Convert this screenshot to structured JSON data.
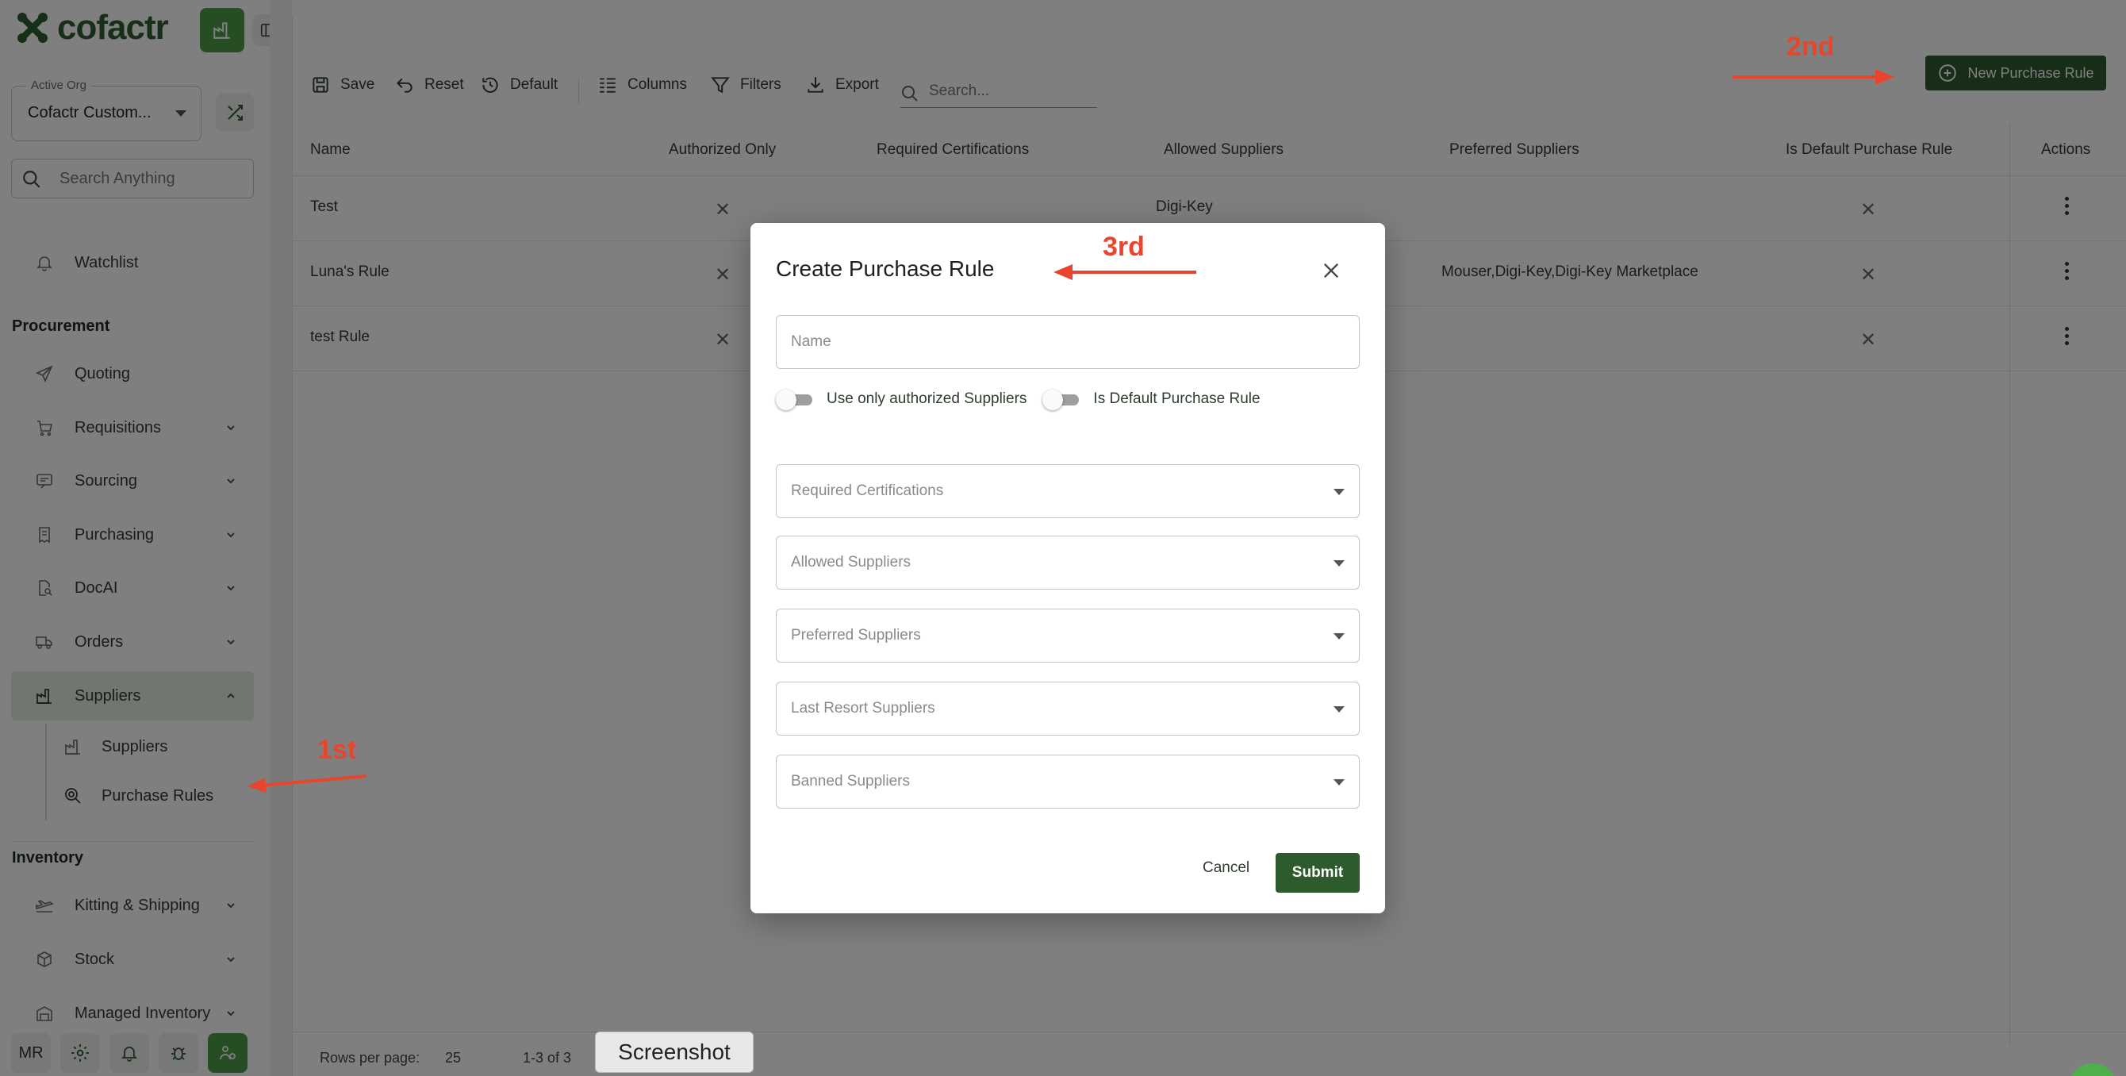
{
  "app": {
    "logo_text": "cofactr"
  },
  "org": {
    "label": "Active Org",
    "value": "Cofactr Custom..."
  },
  "sidebar_search": {
    "placeholder": "Search Anything"
  },
  "nav": {
    "watchlist": "Watchlist",
    "procurement_title": "Procurement",
    "quoting": "Quoting",
    "requisitions": "Requisitions",
    "sourcing": "Sourcing",
    "purchasing": "Purchasing",
    "docai": "DocAI",
    "orders": "Orders",
    "suppliers": "Suppliers",
    "sub_suppliers": "Suppliers",
    "sub_purchase_rules": "Purchase Rules",
    "inventory_title": "Inventory",
    "kitting": "Kitting & Shipping",
    "stock": "Stock",
    "managed_inventory": "Managed Inventory"
  },
  "bottom": {
    "avatar": "MR"
  },
  "toolbar": {
    "save": "Save",
    "reset": "Reset",
    "default": "Default",
    "columns": "Columns",
    "filters": "Filters",
    "export": "Export",
    "search_placeholder": "Search...",
    "new_rule": "New Purchase Rule"
  },
  "table": {
    "headers": {
      "name": "Name",
      "authorized": "Authorized Only",
      "certs": "Required Certifications",
      "allowed": "Allowed Suppliers",
      "preferred": "Preferred Suppliers",
      "is_default": "Is Default Purchase Rule",
      "actions": "Actions"
    },
    "rows": [
      {
        "name": "Test",
        "allowed": "Digi-Key",
        "preferred": ""
      },
      {
        "name": "Luna's Rule",
        "allowed": "",
        "preferred": "Mouser,Digi-Key,Digi-Key Marketplace"
      },
      {
        "name": "test Rule",
        "allowed": "",
        "preferred": ""
      }
    ]
  },
  "footer": {
    "rows_per_page": "Rows per page:",
    "rows_value": "25",
    "range": "1-3 of 3"
  },
  "modal": {
    "title": "Create Purchase Rule",
    "name_placeholder": "Name",
    "toggle_authorized": "Use only authorized Suppliers",
    "toggle_default": "Is Default Purchase Rule",
    "required_certs": "Required Certifications",
    "allowed_suppliers": "Allowed Suppliers",
    "preferred_suppliers": "Preferred Suppliers",
    "last_resort": "Last Resort Suppliers",
    "banned": "Banned Suppliers",
    "cancel": "Cancel",
    "submit": "Submit"
  },
  "annotations": {
    "first": "1st",
    "second": "2nd",
    "third": "3rd"
  },
  "tooltip": "Screenshot",
  "colors": {
    "brand_green": "#2e5b2e",
    "accent_green": "#4f9b4b",
    "annotation_red": "#e8452c"
  }
}
